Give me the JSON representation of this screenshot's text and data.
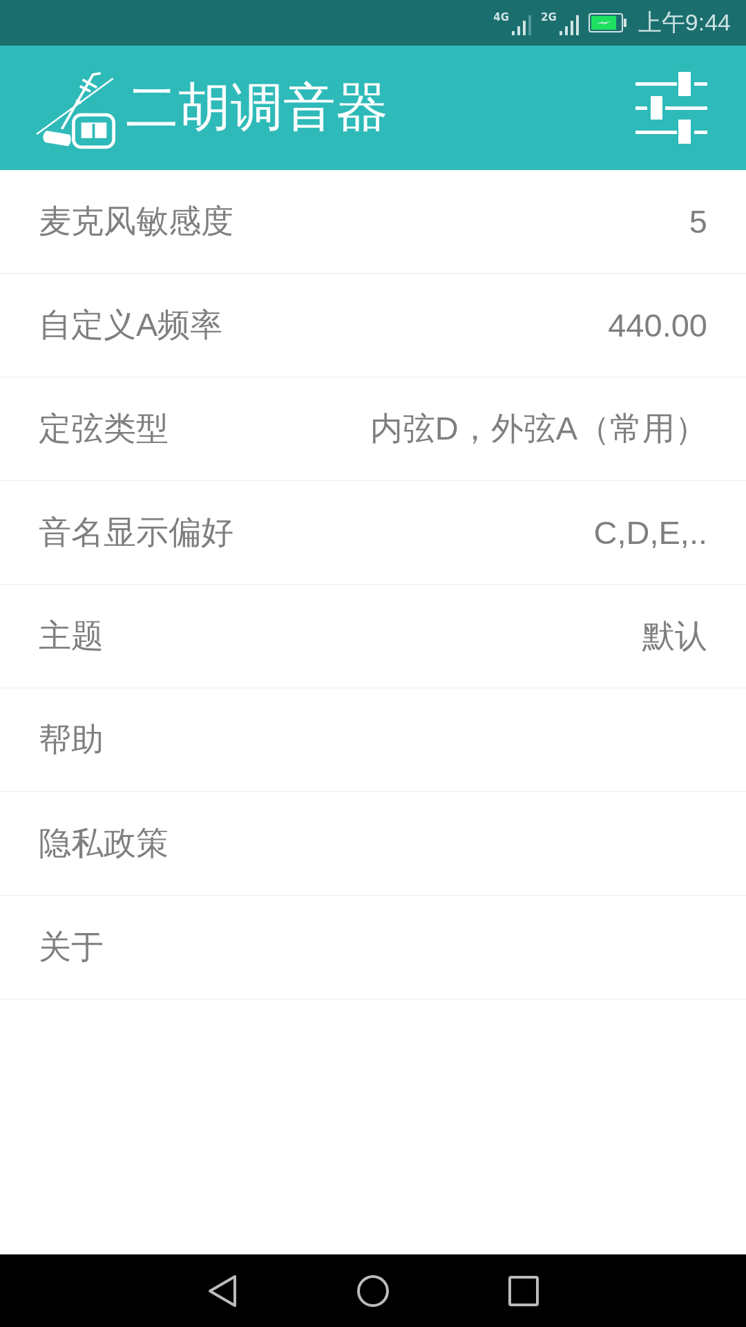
{
  "status_bar": {
    "network_1": "4G",
    "network_2": "2G",
    "time": "上午9:44"
  },
  "app_bar": {
    "title": "二胡调音器"
  },
  "settings": [
    {
      "label": "麦克风敏感度",
      "value": "5"
    },
    {
      "label": "自定义A频率",
      "value": "440.00"
    },
    {
      "label": "定弦类型",
      "value": "内弦D，外弦A（常用）"
    },
    {
      "label": "音名显示偏好",
      "value": "C,D,E,.."
    },
    {
      "label": "主题",
      "value": "默认"
    },
    {
      "label": "帮助"
    },
    {
      "label": "隐私政策"
    },
    {
      "label": "关于"
    }
  ]
}
